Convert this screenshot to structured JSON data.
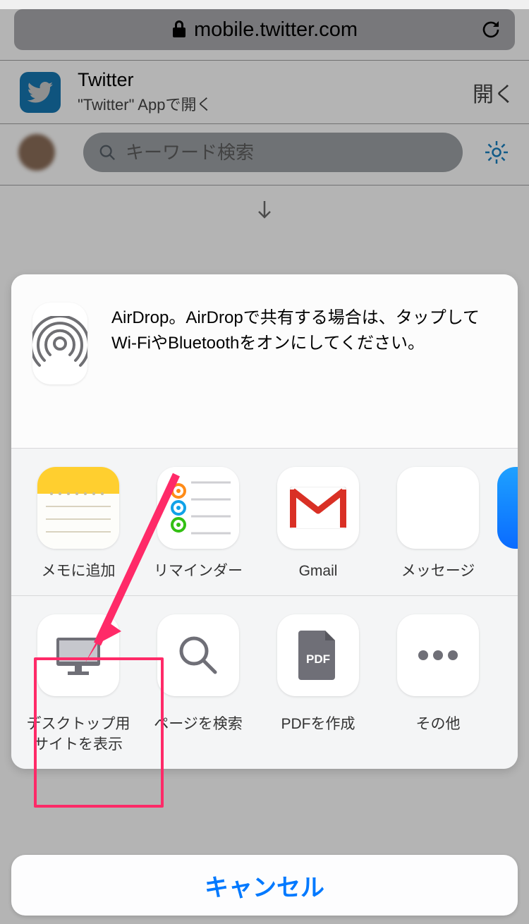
{
  "browser": {
    "url": "mobile.twitter.com"
  },
  "twitter_banner": {
    "title": "Twitter",
    "subtitle": "\"Twitter\" Appで開く",
    "open_label": "開く"
  },
  "search": {
    "placeholder": "キーワード検索"
  },
  "share_sheet": {
    "airdrop_text": "AirDrop。AirDropで共有する場合は、タップしてWi-FiやBluetoothをオンにしてください。",
    "apps_row": [
      {
        "label": "メモに追加"
      },
      {
        "label": "リマインダー"
      },
      {
        "label": "Gmail"
      },
      {
        "label": "メッセージ"
      }
    ],
    "actions_row": [
      {
        "label": "デスクトップ用\nサイトを表示"
      },
      {
        "label": "ページを検索"
      },
      {
        "label": "PDFを作成",
        "pdf_badge": "PDF"
      },
      {
        "label": "その他"
      }
    ],
    "cancel_label": "キャンセル"
  }
}
